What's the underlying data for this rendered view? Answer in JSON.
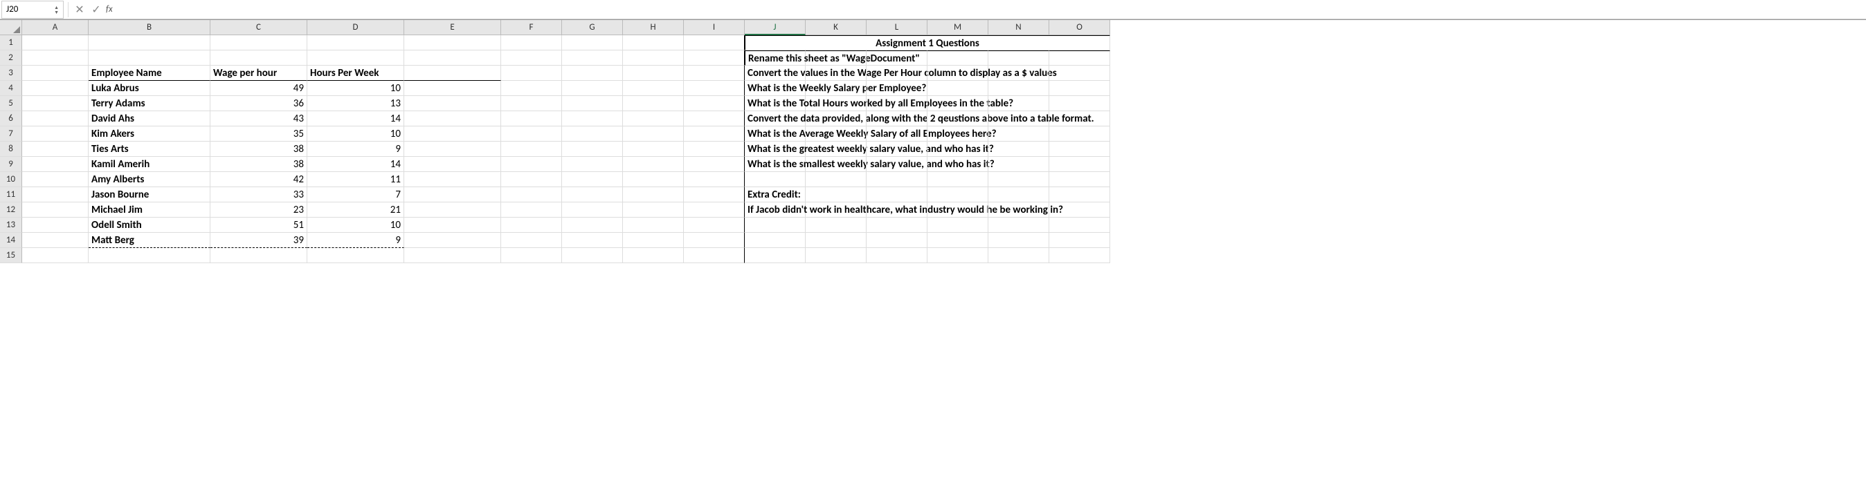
{
  "nameBox": "J20",
  "formula": "",
  "columns": [
    "A",
    "B",
    "C",
    "D",
    "E",
    "F",
    "G",
    "H",
    "I",
    "J",
    "K",
    "L",
    "M",
    "N",
    "O"
  ],
  "rows": [
    1,
    2,
    3,
    4,
    5,
    6,
    7,
    8,
    9,
    10,
    11,
    12,
    13,
    14,
    15
  ],
  "headers": {
    "B": "Employee Name",
    "C": "Wage per hour",
    "D": "Hours Per Week"
  },
  "employees": [
    {
      "name": "Luka Abrus",
      "wage": 49,
      "hours": 10
    },
    {
      "name": "Terry Adams",
      "wage": 36,
      "hours": 13
    },
    {
      "name": "David Ahs",
      "wage": 43,
      "hours": 14
    },
    {
      "name": "Kim Akers",
      "wage": 35,
      "hours": 10
    },
    {
      "name": "Ties Arts",
      "wage": 38,
      "hours": 9
    },
    {
      "name": "Kamil Amerih",
      "wage": 38,
      "hours": 14
    },
    {
      "name": "Amy  Alberts",
      "wage": 42,
      "hours": 11
    },
    {
      "name": "Jason Bourne",
      "wage": 33,
      "hours": 7
    },
    {
      "name": "Michael Jim",
      "wage": 23,
      "hours": 21
    },
    {
      "name": "Odell Smith",
      "wage": 51,
      "hours": 10
    },
    {
      "name": "Matt Berg",
      "wage": 39,
      "hours": 9
    }
  ],
  "assignment": {
    "title": "Assignment 1 Questions",
    "q1": "Rename this sheet as \"WageDocument\"",
    "q2": "Convert the values in the Wage Per Hour column to display as a $ values",
    "q3": "What is the Weekly Salary per Employee?",
    "q4": "What is the Total Hours worked by all Employees  in the table?",
    "q5": "Convert the data provided, along with the 2 qeustions above into a table format.",
    "q6": "What is the Average Weekly Salary of all Employees here?",
    "q7": "What is the greatest weekly salary value, and who has it?",
    "q8": "What is the smallest weekly salary value, and who has it?",
    "extraLabel": "Extra Credit:",
    "extraQ": "If Jacob didn't work in healthcare, what industry would he be working in?"
  },
  "chart_data": {
    "type": "table",
    "title": "Employee Wages",
    "columns": [
      "Employee Name",
      "Wage per hour",
      "Hours Per Week"
    ],
    "rows": [
      [
        "Luka Abrus",
        49,
        10
      ],
      [
        "Terry Adams",
        36,
        13
      ],
      [
        "David Ahs",
        43,
        14
      ],
      [
        "Kim Akers",
        35,
        10
      ],
      [
        "Ties Arts",
        38,
        9
      ],
      [
        "Kamil Amerih",
        38,
        14
      ],
      [
        "Amy  Alberts",
        42,
        11
      ],
      [
        "Jason Bourne",
        33,
        7
      ],
      [
        "Michael Jim",
        23,
        21
      ],
      [
        "Odell Smith",
        51,
        10
      ],
      [
        "Matt Berg",
        39,
        9
      ]
    ]
  }
}
